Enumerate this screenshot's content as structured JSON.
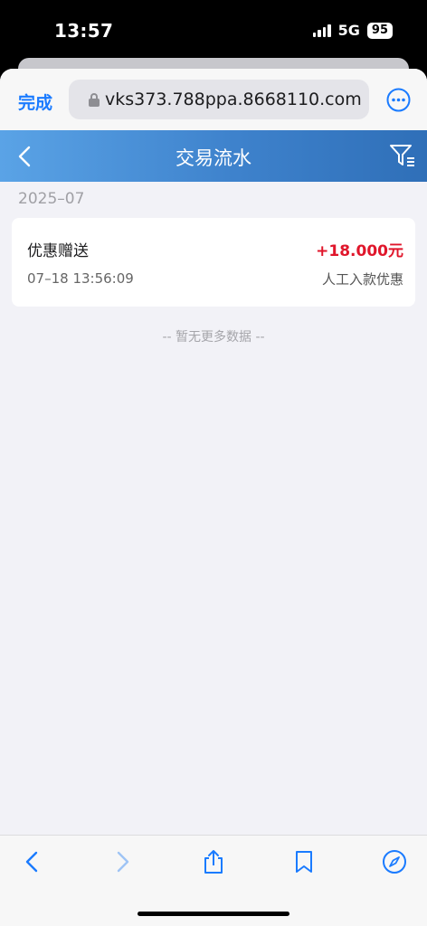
{
  "status_bar": {
    "time": "13:57",
    "network": "5G",
    "battery": "95"
  },
  "browser": {
    "done_label": "完成",
    "url": "vks373.788ppa.8668110.com"
  },
  "header": {
    "title": "交易流水"
  },
  "transactions": {
    "month": "2025–07",
    "records": [
      {
        "title": "优惠赠送",
        "amount": "+18.000元",
        "time": "07–18 13:56:09",
        "type": "人工入款优惠"
      }
    ],
    "end_text": "-- 暂无更多数据 --"
  },
  "colors": {
    "accent": "#1a7bff",
    "header_start": "#5aa3e6",
    "header_end": "#2f6fb8",
    "amount": "#e0162b"
  },
  "icons": {
    "back": "chevron-left-icon",
    "filter": "filter-icon",
    "more": "ellipsis-circle-icon",
    "share": "share-icon",
    "bookmarks": "book-icon",
    "tabs": "compass-icon"
  }
}
